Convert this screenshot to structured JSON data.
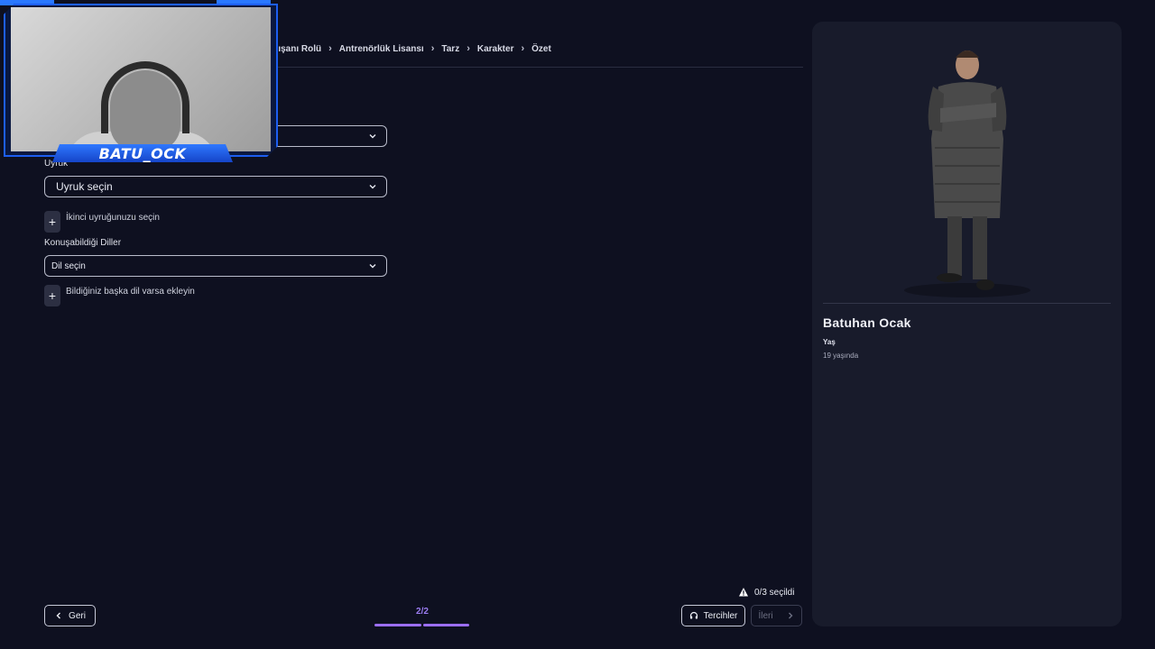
{
  "breadcrumb": {
    "items": [
      "alışanı Rolü",
      "Antrenörlük Lisansı",
      "Tarz",
      "Karakter",
      "Özet"
    ]
  },
  "webcam": {
    "name": "BATU_OCK"
  },
  "form": {
    "nationality_label": "Uyruk",
    "nationality_value": "Uyruk seçin",
    "second_nationality_text": "İkinci uyruğunuzu seçin",
    "languages_label": "Konuşabildiği Diller",
    "language_value": "Dil seçin",
    "add_language_text": "Bildiğiniz başka dil varsa ekleyin"
  },
  "footer": {
    "back_label": "Geri",
    "pager": "2/2",
    "selection_status": "0/3 seçildi",
    "preferences_label": "Tercihler",
    "next_label": "İleri"
  },
  "panel": {
    "name": "Batuhan Ocak",
    "age_label": "Yaş",
    "age_value": "19 yaşında"
  },
  "colors": {
    "background": "#0e1020",
    "panel": "#181b2b",
    "accent": "#9b6ef3",
    "webcam_frame": "#1d5ef0"
  },
  "icons": {
    "chevron": "chevron-down-icon",
    "back": "chevron-left-icon",
    "next": "chevron-right-icon",
    "warning": "warning-icon",
    "preferences": "headset-icon",
    "add": "plus-icon"
  }
}
